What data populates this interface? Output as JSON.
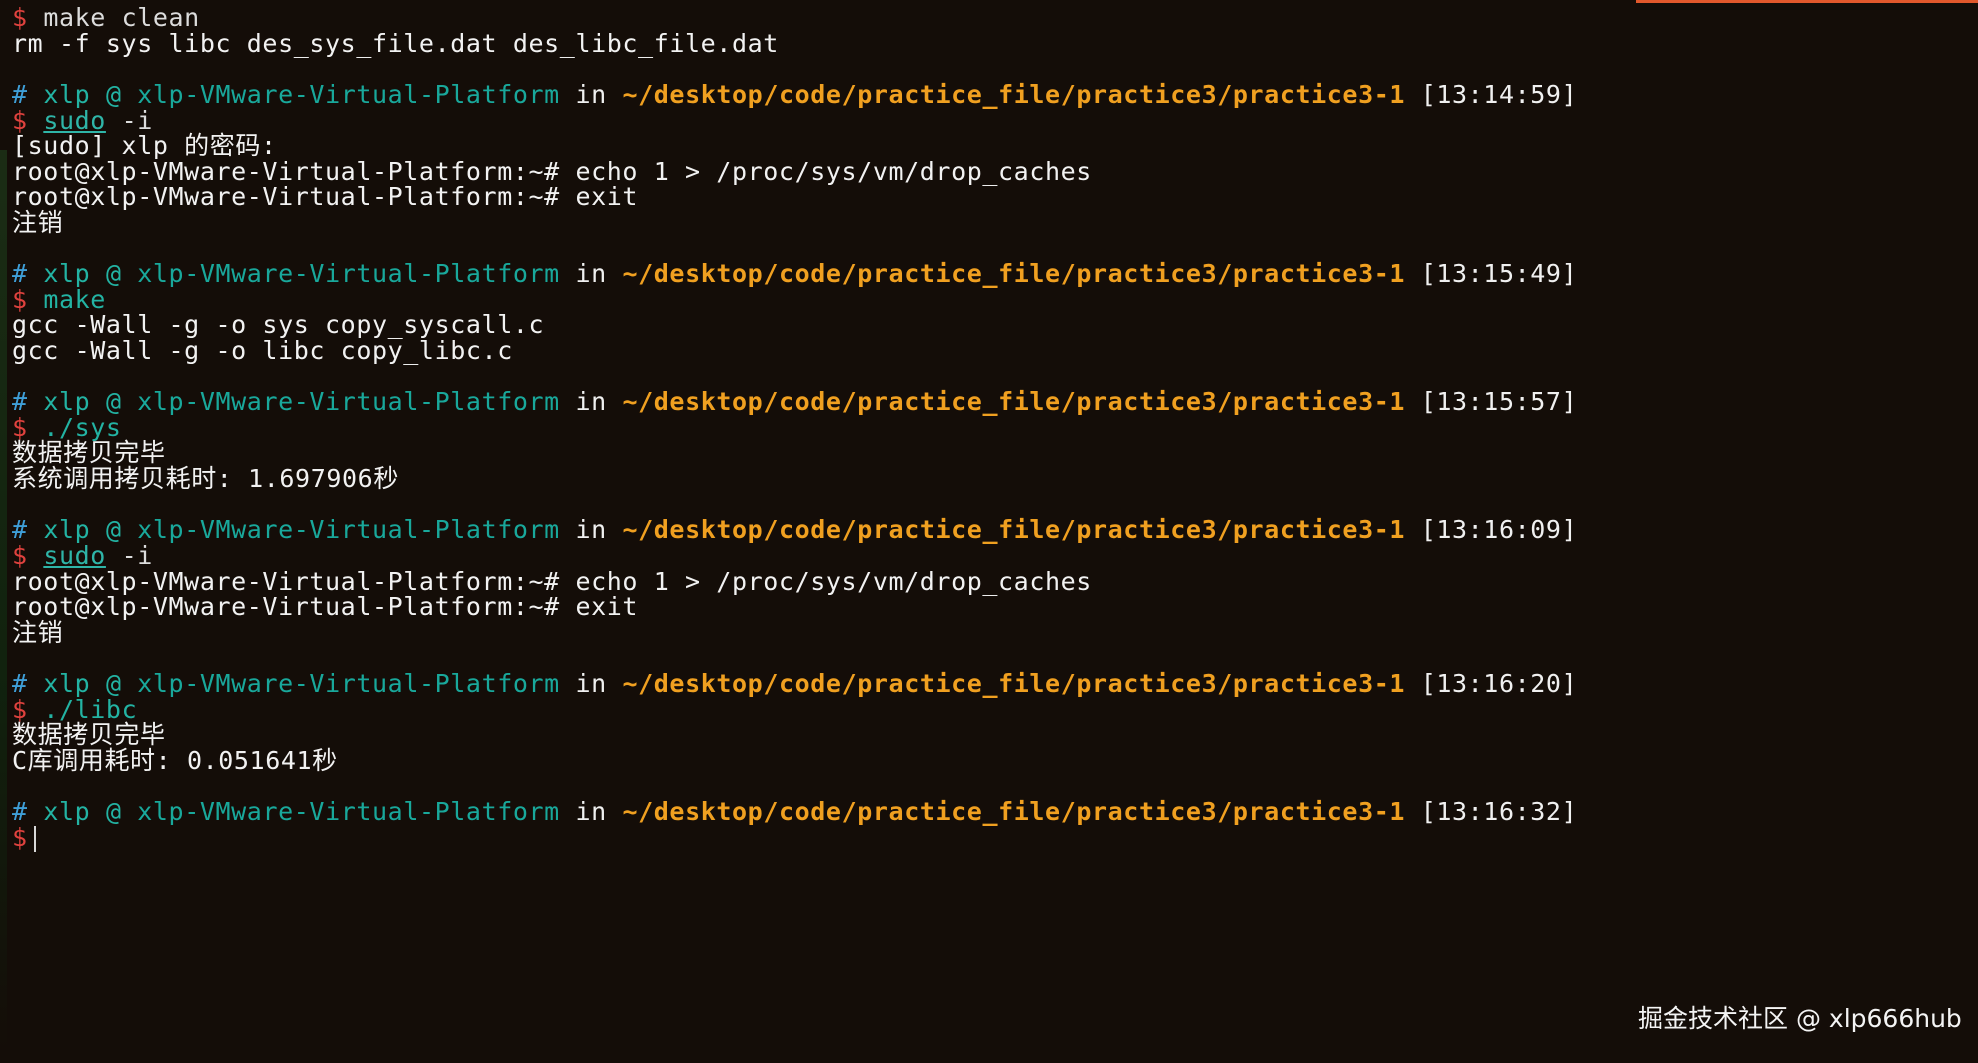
{
  "terminal": {
    "prompt_symbol": "$",
    "lines": [
      {
        "cmd": "make clean"
      },
      {
        "out": "rm -f sys libc des_sys_file.dat des_libc_file.dat"
      },
      {
        "hash": "#",
        "user": "xlp",
        "at": "@",
        "host": "xlp-VMware-Virtual-Platform",
        "in": "in",
        "path": "~/desktop/code/practice_file/practice3/practice3-1",
        "time": "[13:14:59]"
      },
      {
        "cmd_a": "sudo",
        "cmd_b": " -i"
      },
      {
        "out": "[sudo] xlp 的密码:"
      },
      {
        "out": "root@xlp-VMware-Virtual-Platform:~# echo 1 > /proc/sys/vm/drop_caches"
      },
      {
        "out": "root@xlp-VMware-Virtual-Platform:~# exit"
      },
      {
        "out": "注销"
      },
      {
        "hash": "#",
        "user": "xlp",
        "at": "@",
        "host": "xlp-VMware-Virtual-Platform",
        "in": "in",
        "path": "~/desktop/code/practice_file/practice3/practice3-1",
        "time": "[13:15:49]"
      },
      {
        "cmd": "make"
      },
      {
        "out": "gcc -Wall -g -o sys copy_syscall.c"
      },
      {
        "out": "gcc -Wall -g -o libc copy_libc.c"
      },
      {
        "hash": "#",
        "user": "xlp",
        "at": "@",
        "host": "xlp-VMware-Virtual-Platform",
        "in": "in",
        "path": "~/desktop/code/practice_file/practice3/practice3-1",
        "time": "[13:15:57]"
      },
      {
        "cmd": "./sys"
      },
      {
        "out": "数据拷贝完毕"
      },
      {
        "out": "系统调用拷贝耗时: 1.697906秒"
      },
      {
        "hash": "#",
        "user": "xlp",
        "at": "@",
        "host": "xlp-VMware-Virtual-Platform",
        "in": "in",
        "path": "~/desktop/code/practice_file/practice3/practice3-1",
        "time": "[13:16:09]"
      },
      {
        "cmd_a": "sudo",
        "cmd_b": " -i"
      },
      {
        "out": "root@xlp-VMware-Virtual-Platform:~# echo 1 > /proc/sys/vm/drop_caches"
      },
      {
        "out": "root@xlp-VMware-Virtual-Platform:~# exit"
      },
      {
        "out": "注销"
      },
      {
        "hash": "#",
        "user": "xlp",
        "at": "@",
        "host": "xlp-VMware-Virtual-Platform",
        "in": "in",
        "path": "~/desktop/code/practice_file/practice3/practice3-1",
        "time": "[13:16:20]"
      },
      {
        "cmd": "./libc"
      },
      {
        "out": "数据拷贝完毕"
      },
      {
        "out": "C库调用耗时: 0.051641秒"
      },
      {
        "hash": "#",
        "user": "xlp",
        "at": "@",
        "host": "xlp-VMware-Virtual-Platform",
        "in": "in",
        "path": "~/desktop/code/practice_file/practice3/practice3-1",
        "time": "[13:16:32]"
      }
    ]
  },
  "watermark": "掘金技术社区 @ xlp666hub",
  "colors": {
    "background": "#140d08",
    "prompt_dollar": "#e0423e",
    "prompt_hash": "#3f9fd8",
    "hostname": "#19a89b",
    "path": "#f0a020",
    "top_accent": "#e2582c"
  }
}
